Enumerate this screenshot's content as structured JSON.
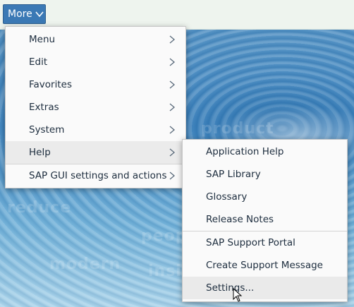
{
  "toolbar": {
    "more_label": "More"
  },
  "background": {
    "words": [
      "product",
      "modern",
      "people",
      "reduce",
      "insight"
    ]
  },
  "main_menu": {
    "items": [
      {
        "label": "Menu",
        "has_submenu": true
      },
      {
        "label": "Edit",
        "has_submenu": true
      },
      {
        "label": "Favorites",
        "has_submenu": true
      },
      {
        "label": "Extras",
        "has_submenu": true
      },
      {
        "label": "System",
        "has_submenu": true
      },
      {
        "label": "Help",
        "has_submenu": true,
        "active": true
      },
      {
        "label": "SAP GUI settings and actions",
        "has_submenu": true
      }
    ]
  },
  "help_menu": {
    "items": [
      {
        "label": "Application Help"
      },
      {
        "label": "SAP Library"
      },
      {
        "label": "Glossary"
      },
      {
        "label": "Release Notes"
      },
      {
        "label": "SAP Support Portal"
      },
      {
        "label": "Create Support Message"
      },
      {
        "label": "Settings...",
        "hovered": true
      }
    ]
  },
  "icons": {
    "more_chevron": "chevron-down-icon",
    "submenu_arrow": "chevron-right-icon",
    "pointer": "mouse-pointer-icon"
  },
  "colors": {
    "more_button_bg": "#3b79b5",
    "menu_bg": "#fafafa",
    "active_item_bg": "#ebebeb",
    "text": "#1d2d3e"
  }
}
